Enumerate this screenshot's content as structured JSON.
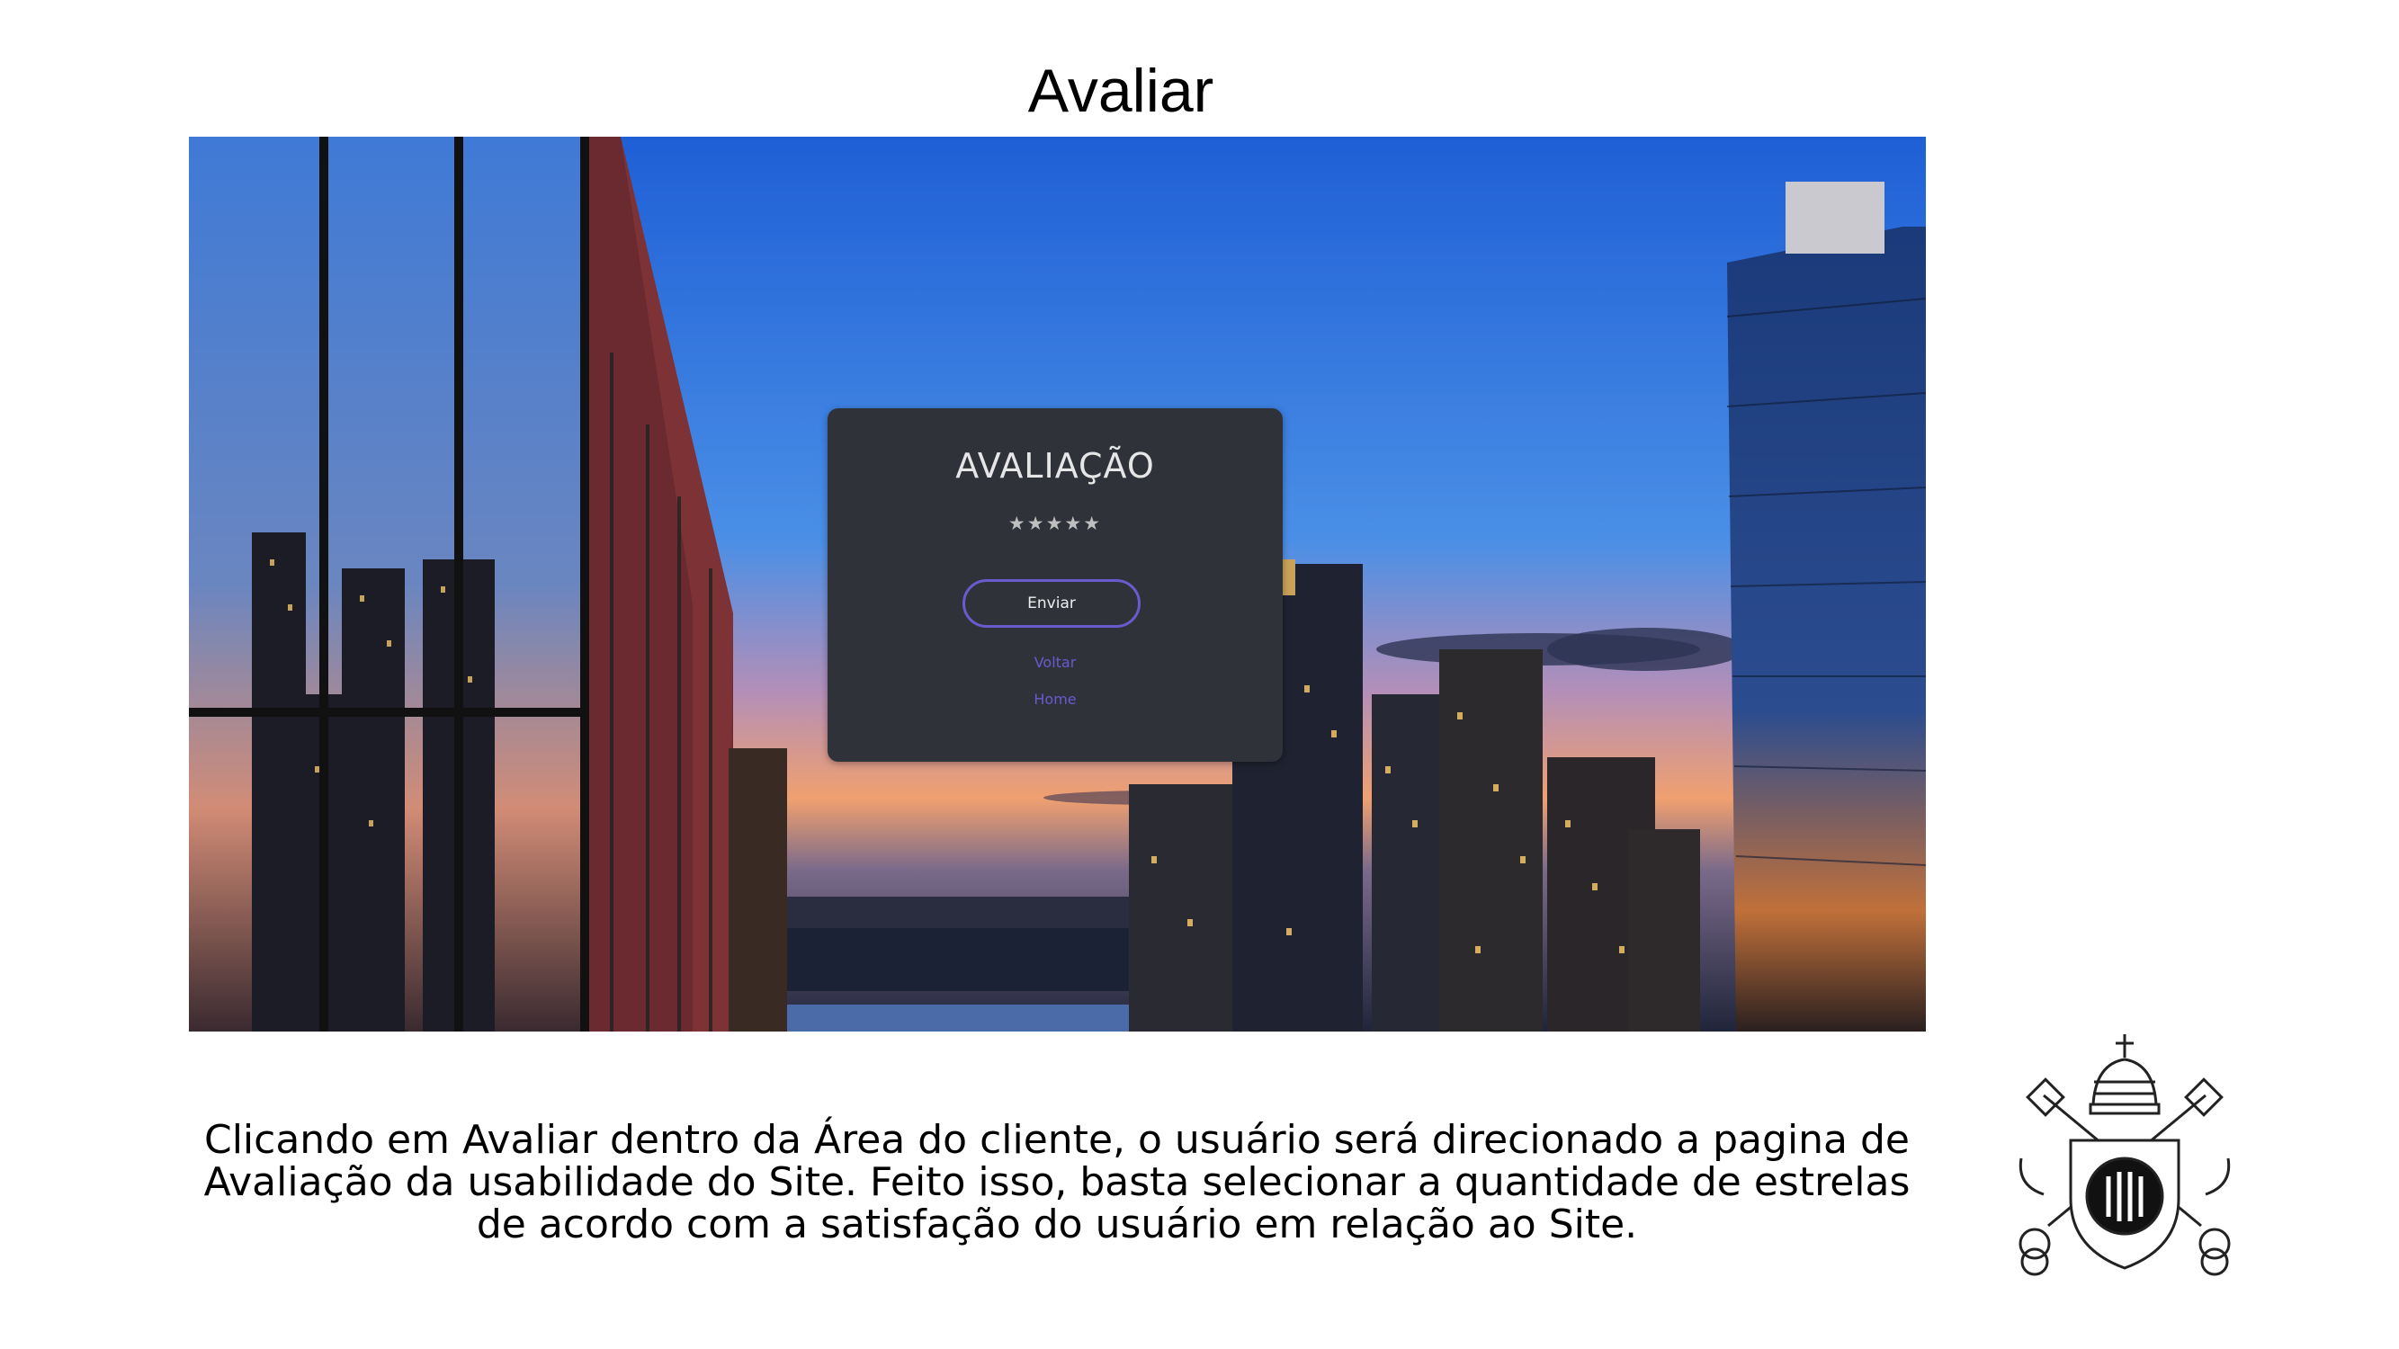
{
  "slide": {
    "title": "Avaliar",
    "caption": "Clicando em Avaliar dentro da Área do cliente, o usuário será direcionado a pagina de Avaliação da usabilidade do Site. Feito isso, basta selecionar a quantidade de estrelas de acordo com a satisfação do usuário em relação ao Site."
  },
  "rating_card": {
    "title": "AVALIAÇÃO",
    "stars": "★★★★★",
    "submit_label": "Enviar",
    "back_link": "Voltar",
    "home_link": "Home"
  },
  "colors": {
    "card_background": "#2f3239",
    "accent": "#6a5acd",
    "star": "#bfbfbf"
  },
  "icons": [
    "university-crest-icon"
  ]
}
